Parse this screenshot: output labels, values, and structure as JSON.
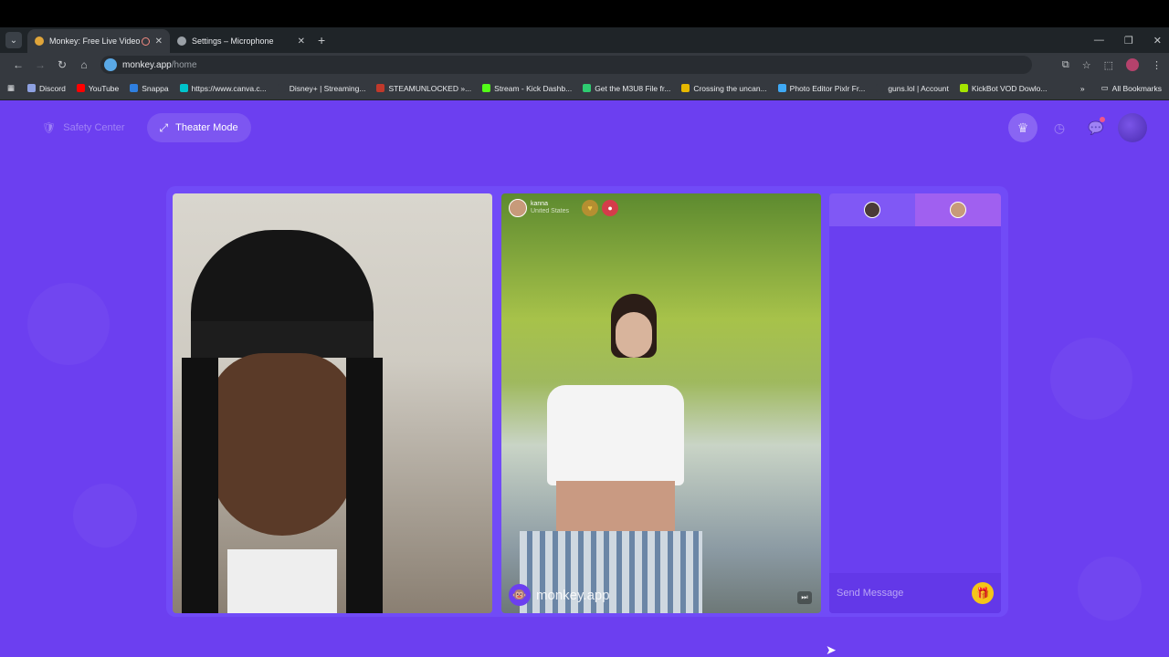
{
  "browser": {
    "tabs": [
      {
        "title": "Monkey: Free Live Video Ch",
        "active": true,
        "favicon_color": "#e0a53a"
      },
      {
        "title": "Settings – Microphone",
        "active": false
      }
    ],
    "new_tab_glyph": "+",
    "address": {
      "host": "monkey.app",
      "path": "/home"
    },
    "bookmarks": [
      {
        "label": "Discord",
        "color": "#8ea1e1"
      },
      {
        "label": "YouTube",
        "color": "#ff0000"
      },
      {
        "label": "Snappa",
        "color": "#2f7fe0"
      },
      {
        "label": "https://www.canva.c...",
        "color": "#00c4cc"
      },
      {
        "label": "Disney+ | Streaming...",
        "color": "#35393f"
      },
      {
        "label": "STEAMUNLOCKED »...",
        "color": "#c0392b"
      },
      {
        "label": "Stream - Kick Dashb...",
        "color": "#53fc18"
      },
      {
        "label": "Get the M3U8 File fr...",
        "color": "#2ecc71"
      },
      {
        "label": "Crossing the uncan...",
        "color": "#e6b800"
      },
      {
        "label": "Photo Editor Pixlr Fr...",
        "color": "#3fa9f5"
      },
      {
        "label": "guns.lol | Account",
        "color": "#35393f"
      },
      {
        "label": "KickBot VOD Dowlo...",
        "color": "#a4e400"
      }
    ],
    "all_bookmarks": "All Bookmarks"
  },
  "page": {
    "safety_center": "Safety Center",
    "theater_mode": "Theater Mode",
    "remote_user": {
      "name": "kanna",
      "country": "United States"
    },
    "watermark": "monkey.app",
    "chat_placeholder": "Send Message"
  },
  "colors": {
    "brand": "#6c3ff0",
    "gift": "#f5c518"
  }
}
